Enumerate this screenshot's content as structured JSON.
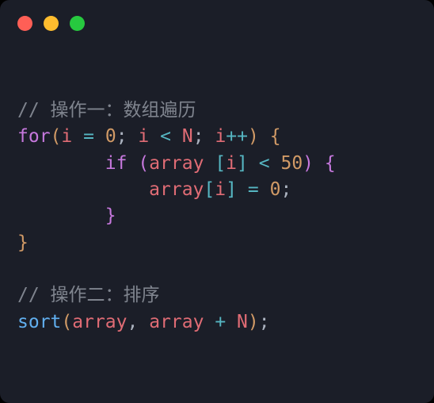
{
  "dots": [
    "red",
    "yellow",
    "green"
  ],
  "code": {
    "c1": "// 操作一：数组遍历",
    "for_kw": "for",
    "i": "i",
    "i2": "i",
    "i3": "i",
    "i4": "i",
    "i5": "i",
    "eq": "=",
    "zero": "0",
    "semi1": ";",
    "lt": "<",
    "N": "N",
    "semi2": ";",
    "pp": "++",
    "if_kw": "if",
    "arr1": "array",
    "arr2": "array",
    "arr3": "array",
    "arr4": "array",
    "lt2": "<",
    "fifty": "50",
    "eq2": "=",
    "zero2": "0",
    "semi3": ";",
    "c2": "// 操作二：排序",
    "sort": "sort",
    "plus": "+",
    "N2": "N",
    "comma": ",",
    "semi4": ";",
    "lp": "(",
    "rp": ")",
    "lp2": "(",
    "rp2": ")",
    "lp3": "(",
    "rp3": ")",
    "lb": "[",
    "rb": "]",
    "lb2": "[",
    "rb2": "]",
    "lc": "{",
    "rc": "}",
    "lc2": "{",
    "rc2": "}",
    "sp": " "
  }
}
